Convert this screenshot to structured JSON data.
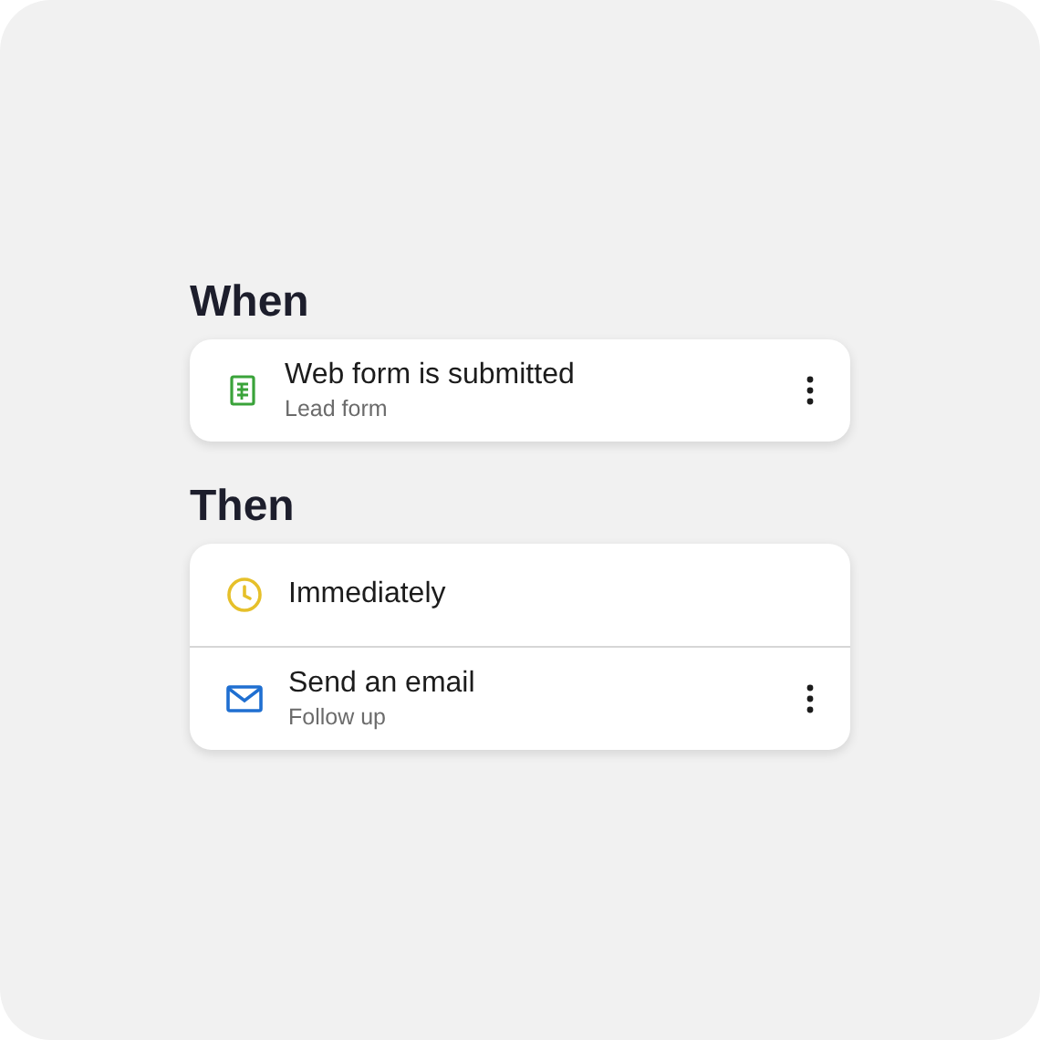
{
  "sections": [
    {
      "heading": "When",
      "rows": [
        {
          "kind": "form",
          "title": "Web form is submitted",
          "subtitle": "Lead form",
          "menu": true
        }
      ]
    },
    {
      "heading": "Then",
      "rows": [
        {
          "kind": "delay",
          "title": "Immediately",
          "menu": false
        },
        {
          "kind": "email",
          "title": "Send an email",
          "subtitle": "Follow up",
          "menu": true
        }
      ]
    }
  ]
}
